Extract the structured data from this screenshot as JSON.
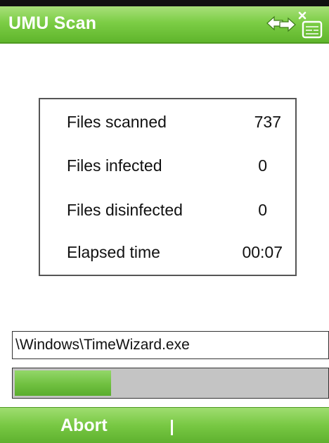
{
  "title_bar": {
    "title": "UMU Scan",
    "icons": [
      "connectivity-icon",
      "no-phone-signal-icon"
    ]
  },
  "stats": {
    "rows": [
      {
        "label": "Files scanned",
        "value": "737"
      },
      {
        "label": "Files infected",
        "value": "0"
      },
      {
        "label": "Files disinfected",
        "value": "0"
      },
      {
        "label": "Elapsed time",
        "value": "00:07"
      }
    ]
  },
  "current_file": "\\Windows\\TimeWizard.exe",
  "progress": {
    "fraction": 0.31
  },
  "softkeys": {
    "left_label": "Abort"
  },
  "colors": {
    "accent_green": "#7ccd45",
    "progress_green": "#70c040",
    "progress_track": "#c4c4c4",
    "text": "#111111"
  }
}
